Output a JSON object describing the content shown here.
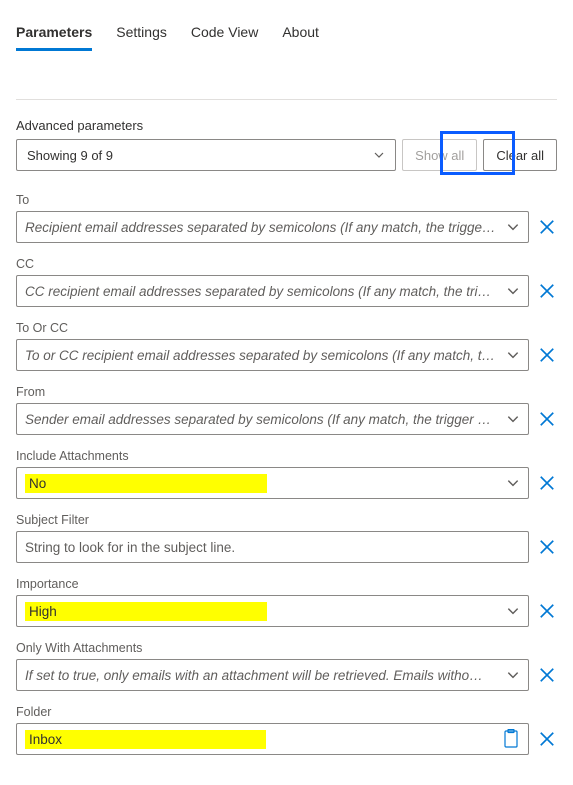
{
  "tabs": {
    "parameters": "Parameters",
    "settings": "Settings",
    "codeview": "Code View",
    "about": "About"
  },
  "advanced": {
    "label": "Advanced parameters",
    "showing": "Showing 9 of 9",
    "show_all": "Show all",
    "clear_all": "Clear all"
  },
  "fields": {
    "to": {
      "label": "To",
      "placeholder": "Recipient email addresses separated by semicolons (If any match, the trigge…"
    },
    "cc": {
      "label": "CC",
      "placeholder": "CC recipient email addresses separated by semicolons (If any match, the tri…"
    },
    "toorcc": {
      "label": "To Or CC",
      "placeholder": "To or CC recipient email addresses separated by semicolons (If any match, t…"
    },
    "from": {
      "label": "From",
      "placeholder": "Sender email addresses separated by semicolons (If any match, the trigger …"
    },
    "includeAttachments": {
      "label": "Include Attachments",
      "value": "No"
    },
    "subjectFilter": {
      "label": "Subject Filter",
      "placeholder": "String to look for in the subject line."
    },
    "importance": {
      "label": "Importance",
      "value": "High"
    },
    "onlyWithAttachments": {
      "label": "Only With Attachments",
      "placeholder": "If set to true, only emails with an attachment will be retrieved. Emails witho…"
    },
    "folder": {
      "label": "Folder",
      "value": "Inbox"
    }
  }
}
